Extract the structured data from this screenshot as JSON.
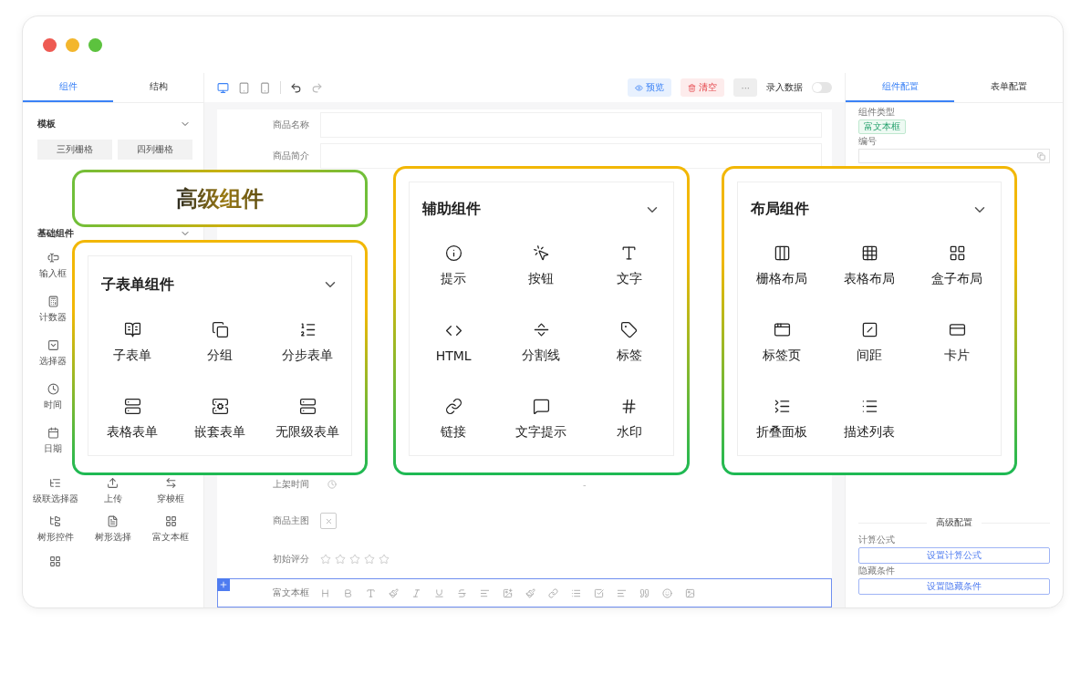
{
  "left_panel": {
    "tabs": [
      {
        "label": "组件",
        "selected": true
      },
      {
        "label": "结构",
        "selected": false
      }
    ],
    "template_section": {
      "title": "模板",
      "expanded": true,
      "items": [
        "三列栅格",
        "四列栅格"
      ]
    },
    "basic_section": {
      "title": "基础组件",
      "expanded": true,
      "items": [
        "输入框",
        "计数器",
        "选择器",
        "时间",
        "日期"
      ],
      "grid_items": [
        "级联选择器",
        "上传",
        "穿梭框",
        "树形控件",
        "树形选择",
        "富文本框"
      ]
    }
  },
  "toolbar": {
    "preview": "预览",
    "clear": "清空",
    "more": "···",
    "record_label": "录入数据",
    "record_on": false
  },
  "form": {
    "rows": [
      {
        "kind": "input",
        "label": "商品名称"
      },
      {
        "kind": "input",
        "label": "商品简介"
      },
      {
        "kind": "time",
        "label": "上架时间",
        "separator": "-"
      },
      {
        "kind": "upload",
        "label": "商品主图",
        "selected": false
      },
      {
        "kind": "rate",
        "label": "初始评分",
        "stars": 0,
        "selected": false
      },
      {
        "kind": "richtext",
        "label": "富文本框",
        "selected": true
      }
    ]
  },
  "right_panel": {
    "tabs": [
      {
        "label": "组件配置",
        "selected": true
      },
      {
        "label": "表单配置",
        "selected": false
      }
    ],
    "type_label": "组件类型",
    "type_tag": "富文本框",
    "id_label": "编号",
    "advanced_title": "高级配置",
    "settings": [
      {
        "label": "计算公式",
        "button": "设置计算公式"
      },
      {
        "label": "隐藏条件",
        "button": "设置隐藏条件"
      }
    ]
  },
  "callout_title": "高级组件",
  "component_groups": [
    {
      "title": "子表单组件",
      "expanded": true,
      "items": [
        "子表单",
        "分组",
        "分步表单",
        "表格表单",
        "嵌套表单",
        "无限级表单"
      ]
    },
    {
      "title": "辅助组件",
      "expanded": true,
      "items": [
        "提示",
        "按钮",
        "文字",
        "HTML",
        "分割线",
        "标签",
        "链接",
        "文字提示",
        "水印"
      ]
    },
    {
      "title": "布局组件",
      "expanded": true,
      "items": [
        "栅格布局",
        "表格布局",
        "盒子布局",
        "标签页",
        "间距",
        "卡片",
        "折叠面板",
        "描述列表"
      ]
    }
  ]
}
